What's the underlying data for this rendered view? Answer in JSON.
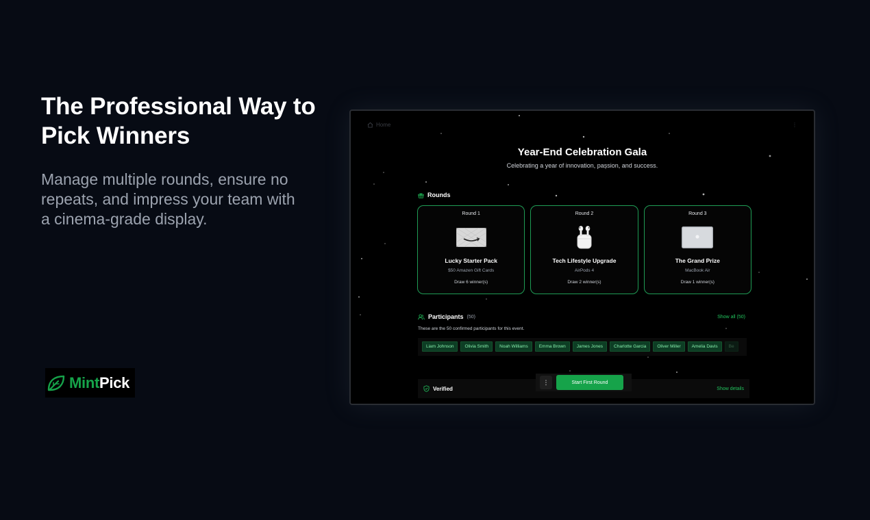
{
  "hero": {
    "title": "The Professional Way to Pick Winners",
    "subtitle": "Manage multiple rounds, ensure no repeats, and impress your team with a cinema-grade display."
  },
  "brand": {
    "name_part1": "Mint",
    "name_part2": "Pick",
    "icon": "leaf-icon",
    "color": "#16a34a"
  },
  "app": {
    "topbar": {
      "home_label": "Home"
    },
    "event": {
      "title": "Year-End Celebration Gala",
      "subtitle": "Celebrating a year of innovation, passion, and success."
    },
    "rounds": {
      "label": "Rounds",
      "items": [
        {
          "round": "Round 1",
          "name": "Lucky Starter Pack",
          "desc": "$50 Amazen Gift Cards",
          "draw": "Draw 6 winner(s)",
          "image": "gift-card"
        },
        {
          "round": "Round 2",
          "name": "Tech Lifestyle Upgrade",
          "desc": "AirPods 4",
          "draw": "Draw 2 winner(s)",
          "image": "airpods"
        },
        {
          "round": "Round 3",
          "name": "The Grand Prize",
          "desc": "MacBook Air",
          "draw": "Draw 1 winner(s)",
          "image": "macbook"
        }
      ]
    },
    "participants": {
      "label": "Participants",
      "count": "(50)",
      "show_all": "Show all (50)",
      "note": "These are the 50 confirmed participants for this event.",
      "names": [
        "Liam Johnson",
        "Olivia Smith",
        "Noah Williams",
        "Emma Brown",
        "James Jones",
        "Charlotte Garcia",
        "Oliver Miller",
        "Amelia Davis",
        "Be"
      ]
    },
    "verified": {
      "label": "Verified",
      "details": "Show details"
    },
    "actions": {
      "menu": "⋮",
      "start": "Start First Round"
    },
    "accent": "#16a34a"
  }
}
